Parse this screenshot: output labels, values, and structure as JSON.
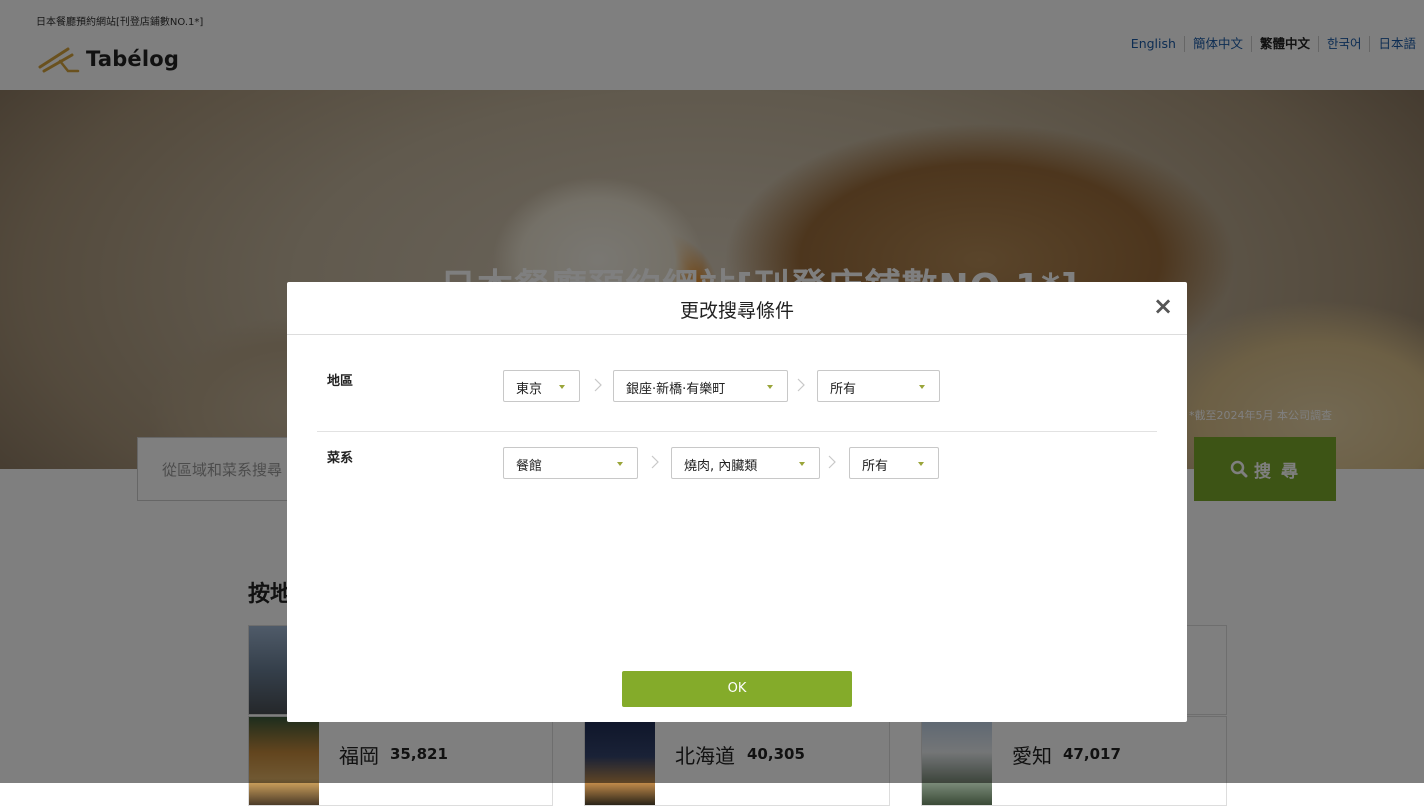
{
  "header": {
    "tagline": "日本餐廳預約網站[刊登店鋪數NO.1*]",
    "logo_text": "Tabélog",
    "languages": [
      {
        "label": "English",
        "active": false
      },
      {
        "label": "簡体中文",
        "active": false
      },
      {
        "label": "繁體中文",
        "active": true
      },
      {
        "label": "한국어",
        "active": false
      },
      {
        "label": "日本語",
        "active": false
      }
    ]
  },
  "hero": {
    "title": "日本餐廳預約網站[刊登店鋪數NO.1*]",
    "note": "*截至2024年5月 本公司調查"
  },
  "search": {
    "placeholder": "從區域和菜系搜尋",
    "button_label": "搜 尋"
  },
  "areas": {
    "section_title": "按地區搜尋",
    "cards": [
      {
        "name": "福岡",
        "count": "35,821"
      },
      {
        "name": "北海道",
        "count": "40,305"
      },
      {
        "name": "愛知",
        "count": "47,017"
      }
    ]
  },
  "modal": {
    "title": "更改搜尋條件",
    "close_symbol": "×",
    "area_row": {
      "label": "地區",
      "selects": [
        "東京",
        "銀座·新橋·有樂町",
        "所有"
      ]
    },
    "cuisine_row": {
      "label": "菜系",
      "selects": [
        "餐館",
        "燒肉, 內臟類",
        "所有"
      ]
    },
    "ok_label": "OK"
  },
  "colors": {
    "accent_green": "#84ab2a",
    "link_blue": "#1a5aa6"
  }
}
